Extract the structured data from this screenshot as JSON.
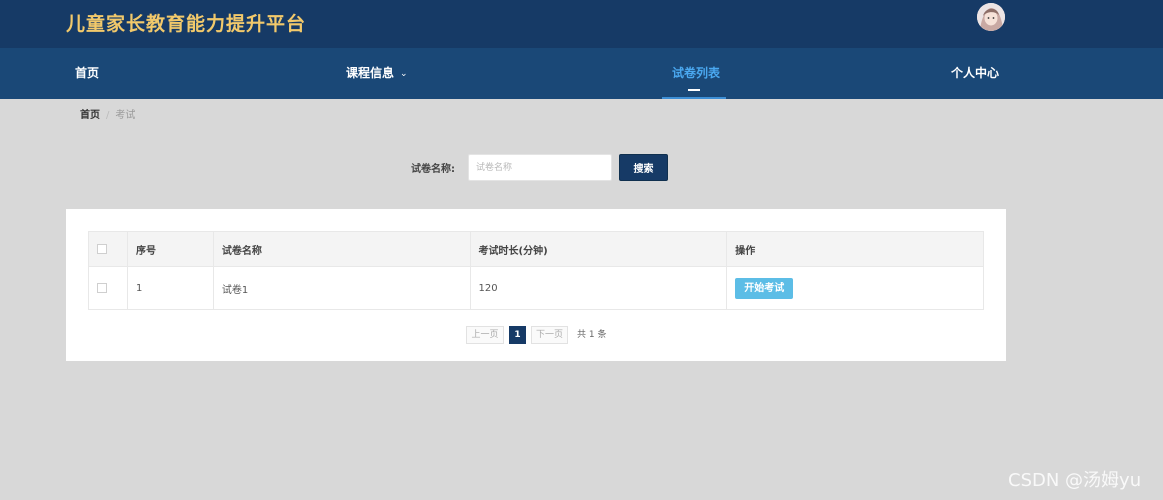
{
  "header": {
    "title": "儿童家长教育能力提升平台"
  },
  "nav": {
    "items": [
      {
        "label": "首页"
      },
      {
        "label": "课程信息"
      },
      {
        "label": "试卷列表"
      },
      {
        "label": "个人中心"
      }
    ],
    "active_index": 2
  },
  "breadcrumb": {
    "home": "首页",
    "separator": "/",
    "current": "考试"
  },
  "search": {
    "label": "试卷名称:",
    "placeholder": "试卷名称",
    "value": "",
    "button_label": "搜索"
  },
  "table": {
    "columns": [
      "序号",
      "试卷名称",
      "考试时长(分钟)",
      "操作"
    ],
    "rows": [
      {
        "index": "1",
        "name": "试卷1",
        "duration": "120",
        "action_label": "开始考试"
      }
    ]
  },
  "pagination": {
    "prev_label": "上一页",
    "current_page": "1",
    "next_label": "下一页",
    "total_text": "共 1 条"
  },
  "watermark": "CSDN @汤姆yu",
  "colors": {
    "header_bg": "#163a66",
    "nav_bg": "#1a4877",
    "title": "#f2c96b",
    "active_nav": "#4aa8f0",
    "start_button": "#5cbde6",
    "page_bg": "#d8d8d8"
  }
}
